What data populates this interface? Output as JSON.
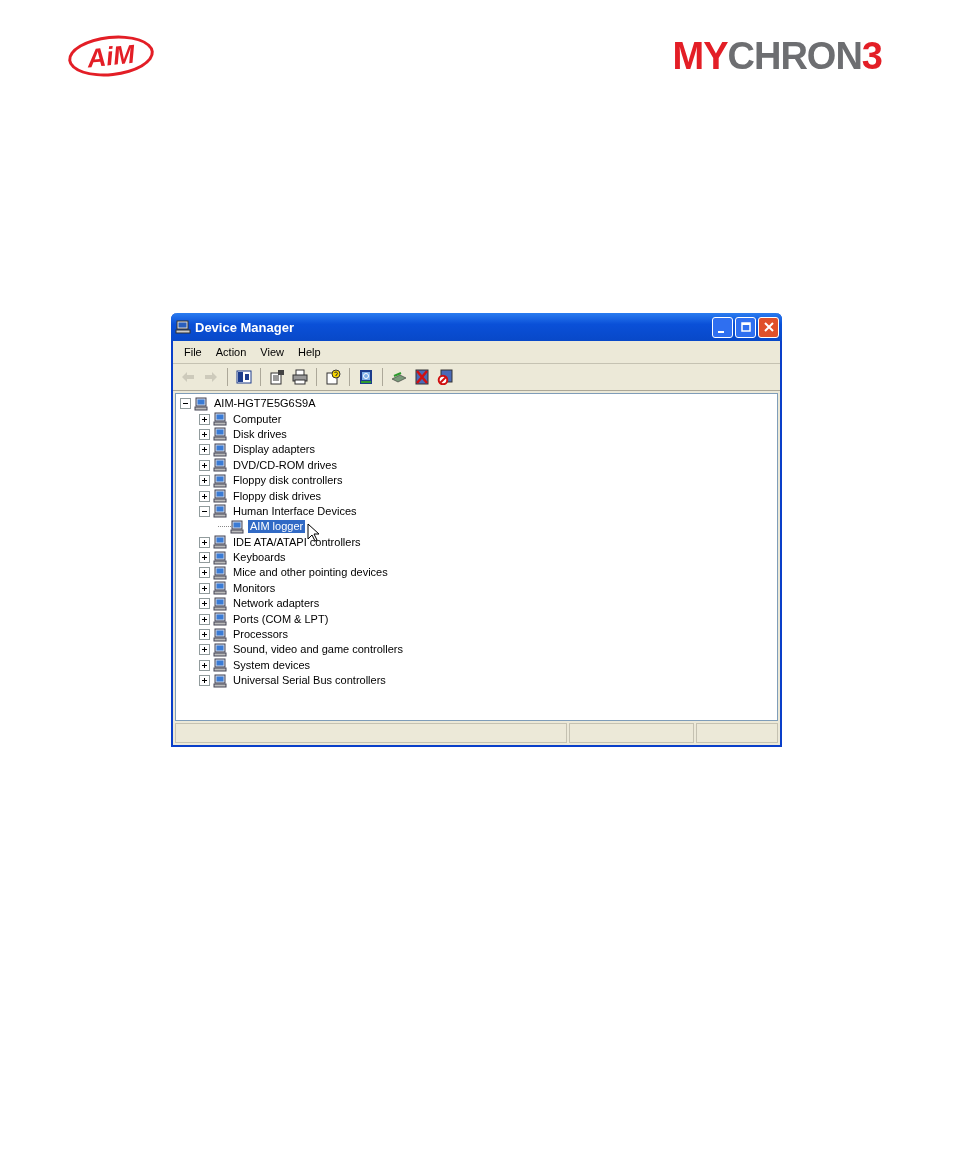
{
  "header": {
    "logo_left": "AiM",
    "logo_right": [
      {
        "text": "MY",
        "color": "#e31e26"
      },
      {
        "text": "CHRON",
        "color": "#6d6e71"
      },
      {
        "text": "3",
        "color": "#e31e26"
      }
    ]
  },
  "window": {
    "title": "Device Manager"
  },
  "menu": [
    "File",
    "Action",
    "View",
    "Help"
  ],
  "toolbar": [
    {
      "kind": "back",
      "disabled": true
    },
    {
      "kind": "forward",
      "disabled": true
    },
    {
      "kind": "sep"
    },
    {
      "kind": "tree",
      "disabled": false
    },
    {
      "kind": "sep"
    },
    {
      "kind": "properties",
      "disabled": false
    },
    {
      "kind": "print",
      "disabled": false
    },
    {
      "kind": "sep"
    },
    {
      "kind": "help",
      "disabled": false
    },
    {
      "kind": "sep"
    },
    {
      "kind": "scan",
      "disabled": false
    },
    {
      "kind": "sep"
    },
    {
      "kind": "update",
      "disabled": false
    },
    {
      "kind": "uninstall",
      "disabled": false
    },
    {
      "kind": "disable",
      "disabled": false
    }
  ],
  "tree": {
    "label": "AIM-HGT7E5G6S9A",
    "expanded": true,
    "selected": false,
    "children": [
      {
        "label": "Computer",
        "expanded": false,
        "selected": false
      },
      {
        "label": "Disk drives",
        "expanded": false,
        "selected": false
      },
      {
        "label": "Display adapters",
        "expanded": false,
        "selected": false
      },
      {
        "label": "DVD/CD-ROM drives",
        "expanded": false,
        "selected": false
      },
      {
        "label": "Floppy disk controllers",
        "expanded": false,
        "selected": false
      },
      {
        "label": "Floppy disk drives",
        "expanded": false,
        "selected": false
      },
      {
        "label": "Human Interface Devices",
        "expanded": true,
        "selected": false,
        "children": [
          {
            "label": "AIM logger",
            "selected": true
          }
        ]
      },
      {
        "label": "IDE ATA/ATAPI controllers",
        "expanded": false,
        "selected": false
      },
      {
        "label": "Keyboards",
        "expanded": false,
        "selected": false
      },
      {
        "label": "Mice and other pointing devices",
        "expanded": false,
        "selected": false
      },
      {
        "label": "Monitors",
        "expanded": false,
        "selected": false
      },
      {
        "label": "Network adapters",
        "expanded": false,
        "selected": false
      },
      {
        "label": "Ports (COM & LPT)",
        "expanded": false,
        "selected": false
      },
      {
        "label": "Processors",
        "expanded": false,
        "selected": false
      },
      {
        "label": "Sound, video and game controllers",
        "expanded": false,
        "selected": false
      },
      {
        "label": "System devices",
        "expanded": false,
        "selected": false
      },
      {
        "label": "Universal Serial Bus controllers",
        "expanded": false,
        "selected": false
      }
    ]
  }
}
